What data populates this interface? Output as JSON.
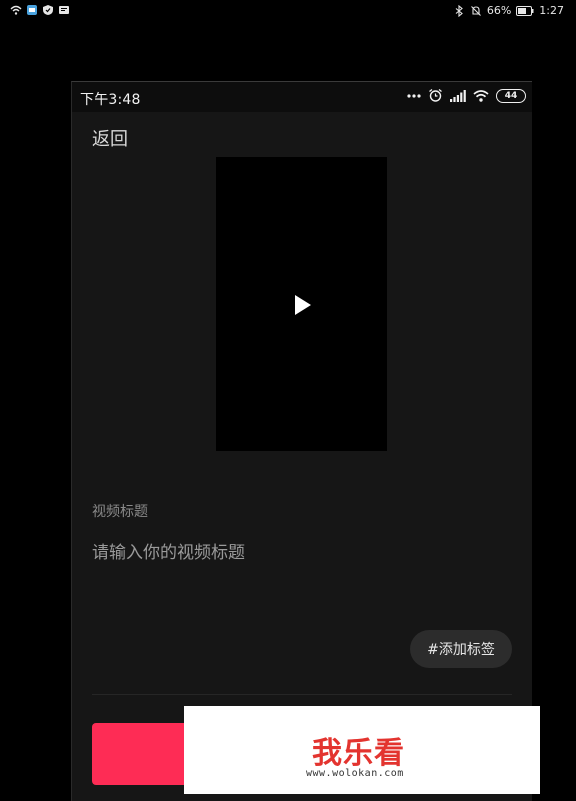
{
  "host_status_bar": {
    "battery_percent": "66%",
    "time": "1:27"
  },
  "phone_status_bar": {
    "time": "下午3:48",
    "battery_level": "44"
  },
  "header": {
    "back_label": "返回"
  },
  "video_preview": {
    "play_icon": "play-icon"
  },
  "title_field": {
    "label": "视频标题",
    "placeholder": "请输入你的视频标题",
    "value": ""
  },
  "tag_button": {
    "label": "#添加标签"
  },
  "watermark": {
    "logo_text": "我乐看",
    "url": "www.wolokan.com"
  },
  "colors": {
    "accent": "#fe2c55",
    "background": "#161616"
  }
}
